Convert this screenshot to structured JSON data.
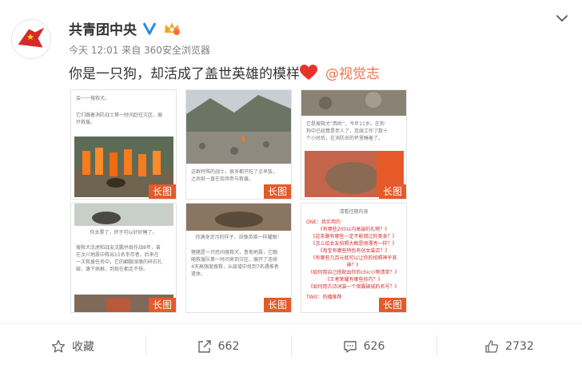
{
  "post": {
    "username": "共青团中央",
    "meta": "今天 12:01 来自 360安全浏览器",
    "text": "你是一只狗，却活成了盖世英雄的模样",
    "mention": "@视觉志"
  },
  "thumbnails": {
    "badge": "长图",
    "t1": {
      "line1": "会一一搜救犬。",
      "line2": "它们跟着消防战士第一时间赶往灾区，展",
      "line3": "开救援。"
    },
    "t2": {
      "line1": "这群特殊的战士，很多都只吃了点早饭，",
      "line2": "之后就一直在现场参与救援。"
    },
    "t3": {
      "line1": "它是搜救犬“西岭”，今年11岁。在狗",
      "line2": "狗中已经算是老人了，连续工作了数十",
      "line3": "个小时后，在消防员的怀里睡着了。"
    },
    "t4": {
      "line1": "你太累了，终于可以好好睡了。",
      "line2": "搜救犬沈虎和战友沈鹏并肩作战8年，曾",
      "line3": "在汶川地震中救出15名幸存者，后来在",
      "line4": "一次救援任务中，它的翻腿溺落的碎石扎",
      "line5": "破，落下病根，到现在都走不快。"
    },
    "t5": {
      "line1": "你满身泥污的样子，却像英雄一样耀眼！",
      "line2": "猪猪是一只民间搜救犬，鲁甸地震，它跟",
      "line3": "随救援队第一时间来到灾区，展开了连续",
      "line4": "4天高强度搜救，从废墟中找到7名遇难者",
      "line5": "遗体。"
    },
    "t6": {
      "line1": "请看往期内容",
      "line2": "ONE：我实用的",
      "items": [
        "《有哪些200以内高端的礼物？》",
        "《这条路有哪些一定不能错过的美食？》",
        "《怎么给女友拍照大概是很漂亮一样？》",
        "《淘宝有哪些特色有创女装店？》",
        "《有哪些几百元就可以让你的拍照神乎其神？》",
        "《如何用自己搭配出你的chic小物清单？》",
        "《王者荣耀有哪些技巧？》",
        "《如何用古诗词装一个错霸破城的名号？》"
      ],
      "line3": "TWO：热播推荐"
    }
  },
  "actions": {
    "favorite": "收藏",
    "repost": "662",
    "comment": "626",
    "like": "2732"
  },
  "colors": {
    "accent": "#eb7350",
    "badge": "#e55a2b",
    "verified": "#2b8cdf"
  }
}
